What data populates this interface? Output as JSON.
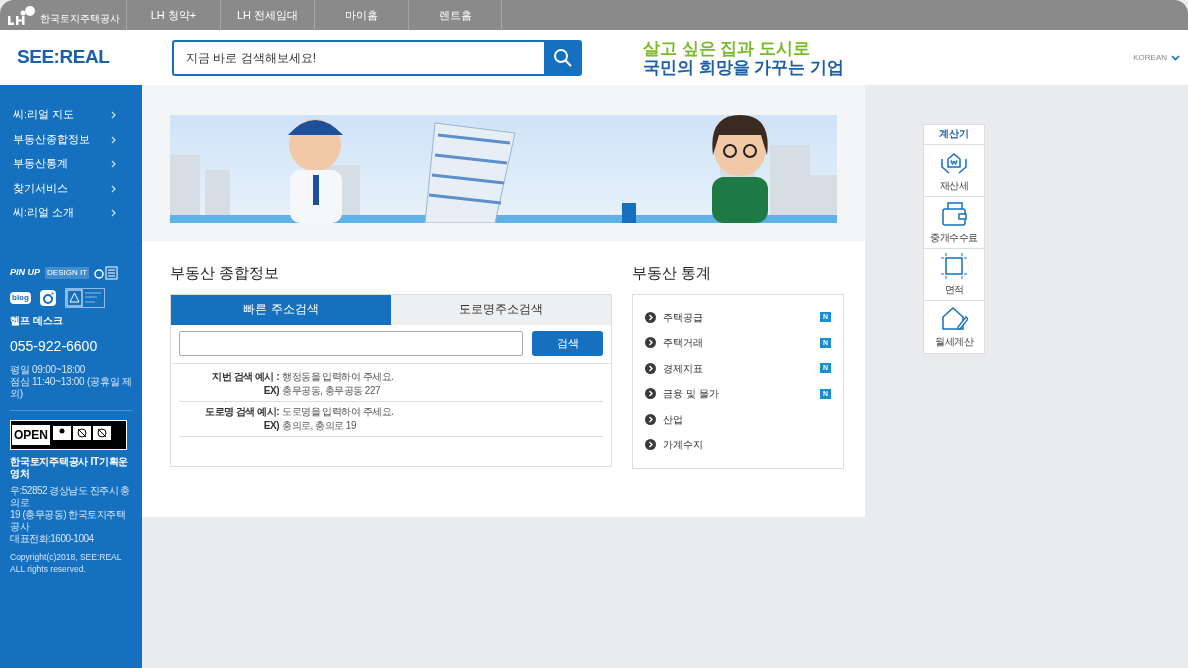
{
  "top_bar": {
    "logo_caption": "한국토지주택공사",
    "links": [
      "LH 청약+",
      "LH 전세임대",
      "마이홈",
      "렌트홈"
    ]
  },
  "header": {
    "logo": "SEE:REAL",
    "search": {
      "placeholder": "지금 바로 검색해보세요!"
    },
    "slogan_line_1": "살고 싶은 집과 도시로",
    "slogan_line_2": "국민의 희망을 가꾸는 기업",
    "language": "KOREAN"
  },
  "sidebar": {
    "items": [
      "씨:리얼 지도",
      "부동산종합정보",
      "부동산통계",
      "찾기서비스",
      "씨:리얼 소개"
    ],
    "badges": [
      "PIN UP",
      "DESIGN IT",
      "blog",
      "OPEN"
    ],
    "help_title": "헬프 데스크",
    "phone": "055-922-6600",
    "hours": [
      "평일 09:00~18:00",
      "점심 11:40~13:00 (공휴일 제외)"
    ],
    "org": "한국토지주택공사 IT기획운영처",
    "address": [
      "우:52852 경상남도 진주시 충의로",
      "19 (충무공동) 한국토지주택공사",
      "대표전화:1600-1004"
    ],
    "copyright": [
      "Copyright(c)2018, SEE:REAL",
      "ALL rights reserved."
    ]
  },
  "info_panel": {
    "title": "부동산 종합정보",
    "tabs": [
      {
        "label": "빠른 주소검색",
        "selected": true
      },
      {
        "label": "도로명주소검색",
        "selected": false
      }
    ],
    "search_button": "검색",
    "examples": [
      {
        "label": "지번 검색 예시 :",
        "text": "행정동을 입력하여 주세요.",
        "ex_label": "EX)",
        "ex": "충무공동, 충무공동 227"
      },
      {
        "label": "도로명 검색 예시:",
        "text": "도로명을 입력하여 주세요.",
        "ex_label": "EX)",
        "ex": "충의로, 충의로 19"
      }
    ]
  },
  "stats_panel": {
    "title": "부동산 통계",
    "items": [
      {
        "label": "주택공급",
        "new": true,
        "badge": "N"
      },
      {
        "label": "주택거래",
        "new": true,
        "badge": "N"
      },
      {
        "label": "경제지표",
        "new": true,
        "badge": "N"
      },
      {
        "label": "금융 및 물가",
        "new": true,
        "badge": "N"
      },
      {
        "label": "산업",
        "new": false
      },
      {
        "label": "가계수지",
        "new": false
      }
    ]
  },
  "calculator": {
    "title": "계산기",
    "items": [
      {
        "kind": "tax",
        "label": "재산세"
      },
      {
        "kind": "fee",
        "label": "중개수수료"
      },
      {
        "kind": "area",
        "label": "면적"
      },
      {
        "kind": "rent",
        "label": "월세계산"
      }
    ]
  }
}
